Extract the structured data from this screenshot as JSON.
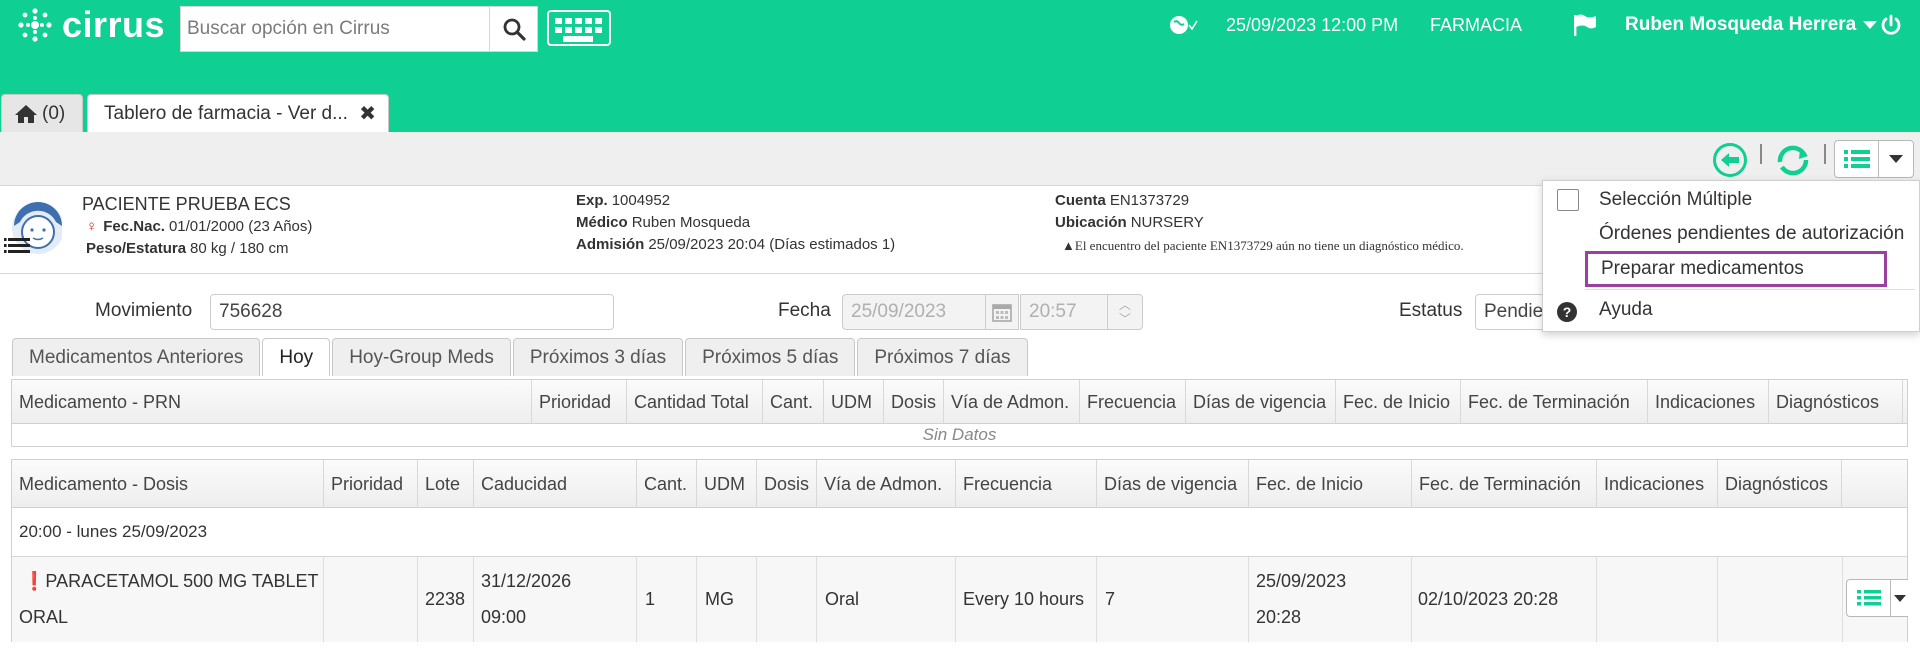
{
  "app": {
    "name": "cirrus"
  },
  "search": {
    "placeholder": "Buscar opción en Cirrus"
  },
  "header": {
    "datetime": "25/09/2023 12:00 PM",
    "department": "FARMACIA",
    "user": "Ruben Mosqueda Herrera"
  },
  "tabs": [
    {
      "label": "(0)"
    },
    {
      "label": "Tablero de farmacia - Ver d..."
    }
  ],
  "patient": {
    "name": "PACIENTE PRUEBA ECS",
    "dob_label": "Fec.Nac.",
    "dob": "01/01/2000 (23 Años)",
    "weight_label": "Peso/Estatura",
    "weight": "80 kg / 180 cm",
    "exp_label": "Exp.",
    "exp": "1004952",
    "doctor_label": "Médico",
    "doctor": "Ruben Mosqueda",
    "admission_label": "Admisión",
    "admission": "25/09/2023 20:04 (Días estimados 1)",
    "account_label": "Cuenta",
    "account": "EN1373729",
    "location_label": "Ubicación",
    "location": "NURSERY",
    "warning": "El encuentro del paciente EN1373729 aún no tiene un diagnóstico médico."
  },
  "form": {
    "movimiento_label": "Movimiento",
    "movimiento": "756628",
    "fecha_label": "Fecha",
    "fecha": "25/09/2023",
    "hora": "20:57",
    "estatus_label": "Estatus",
    "estatus": "Pendie"
  },
  "content_tabs": [
    "Medicamentos Anteriores",
    "Hoy",
    "Hoy-Group Meds",
    "Próximos 3 días",
    "Próximos 5 días",
    "Próximos 7 días"
  ],
  "prn_table": {
    "headers": [
      "Medicamento - PRN",
      "Prioridad",
      "Cantidad Total",
      "Cant.",
      "UDM",
      "Dosis",
      "Vía de Admon.",
      "Frecuencia",
      "Días de vigencia",
      "Fec. de Inicio",
      "Fec. de Terminación",
      "Indicaciones",
      "Diagnósticos"
    ],
    "empty": "Sin Datos"
  },
  "dose_table": {
    "headers": [
      "Medicamento - Dosis",
      "Prioridad",
      "Lote",
      "Caducidad",
      "Cant.",
      "UDM",
      "Dosis",
      "Vía de Admon.",
      "Frecuencia",
      "Días de vigencia",
      "Fec. de Inicio",
      "Fec. de Terminación",
      "Indicaciones",
      "Diagnósticos"
    ],
    "group": "20:00 - lunes 25/09/2023",
    "row": {
      "med_line1": "PARACETAMOL 500 MG TABLET",
      "med_line2": "ORAL",
      "lote": "2238",
      "cad_line1": "31/12/2026",
      "cad_line2": "09:00",
      "cant": "1",
      "udm": "MG",
      "via": "Oral",
      "frecuencia": "Every 10 hours",
      "dias": "7",
      "inicio_line1": "25/09/2023",
      "inicio_line2": "20:28",
      "terminacion": "02/10/2023 20:28"
    }
  },
  "menu": {
    "items": [
      "Selección Múltiple",
      "Órdenes pendientes de autorización",
      "Preparar medicamentos",
      "Ayuda"
    ]
  },
  "colors": {
    "brand": "#0fcf93",
    "highlight": "#9b3fa0",
    "priority_icon": "#e0218a"
  }
}
